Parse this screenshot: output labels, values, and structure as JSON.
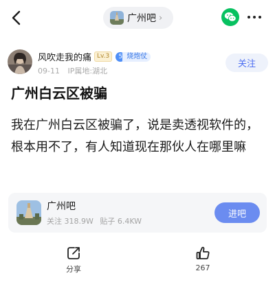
{
  "topbar": {
    "back_icon": "chevron-left-icon",
    "forum_name": "广州吧",
    "chevron": "›",
    "share_icon": "wechat-icon",
    "more_icon": "more-horizontal-icon"
  },
  "author": {
    "name": "风吹走我的痛",
    "level": "Lv.3",
    "rank_number": "5",
    "rank_title": "烧炮仗",
    "date": "09-11",
    "ip_location": "IP属地:湖北",
    "follow_label": "关注"
  },
  "post": {
    "title": "广州白云区被骗",
    "body": "我在广州白云区被骗了，说是卖透视软件的，根本用不了，有人知道现在那伙人在哪里嘛"
  },
  "forum_card": {
    "name": "广州吧",
    "followers": "关注 318.9W",
    "posts": "贴子 6.4KW",
    "enter_label": "进吧"
  },
  "actions": {
    "share_label": "分享",
    "like_count": "267",
    "share_icon": "share-icon",
    "like_icon": "thumbs-up-icon"
  },
  "colors": {
    "accent": "#6b8cf0",
    "follow_text": "#4e6ff2",
    "wechat": "#07c160"
  }
}
